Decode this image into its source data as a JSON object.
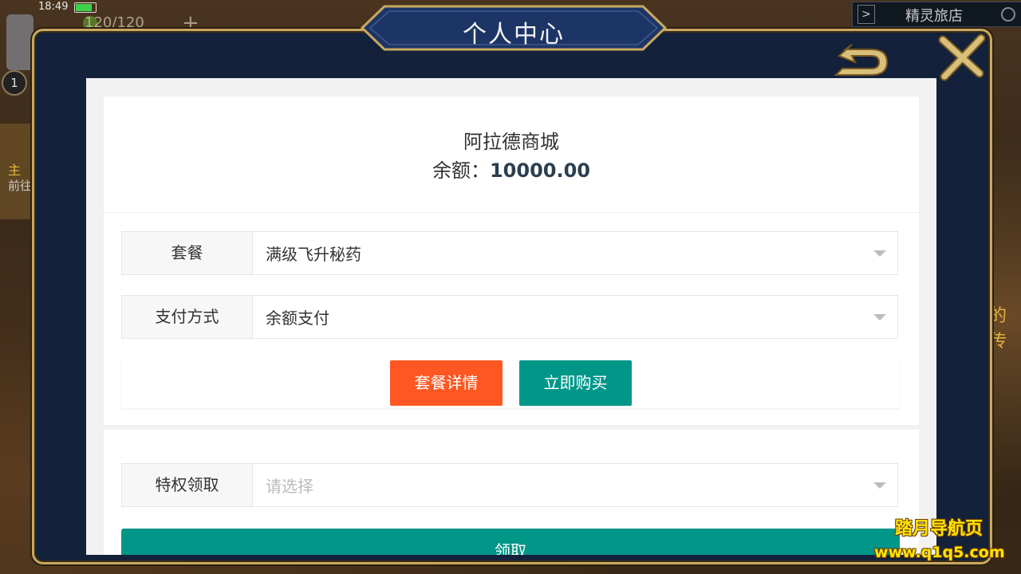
{
  "statusbar": {
    "time": "18:49"
  },
  "hud": {
    "stamina": "120/120",
    "plus": "+",
    "level": "1",
    "quest_title": "主",
    "quest_sub": "前往",
    "inn_arrow": ">",
    "inn_label": "精灵旅店",
    "right_text": "的传"
  },
  "modal": {
    "title": "个人中心"
  },
  "shop": {
    "name": "阿拉德商城",
    "balance_label": "余额：",
    "balance_value": "10000.00"
  },
  "form": {
    "package": {
      "label": "套餐",
      "value": "满级飞升秘药"
    },
    "payment": {
      "label": "支付方式",
      "value": "余额支付"
    },
    "detail_button": "套餐详情",
    "buy_button": "立即购买",
    "privilege": {
      "label": "特权领取",
      "placeholder": "请选择"
    },
    "claim_button": "领取"
  },
  "watermark": {
    "line1": "踏月导航页",
    "line2": "www.q1q5.com"
  },
  "colors": {
    "accent_orange": "#ff5722",
    "accent_teal": "#009688",
    "frame_navy": "#14213a",
    "frame_gold": "#c8a860"
  }
}
